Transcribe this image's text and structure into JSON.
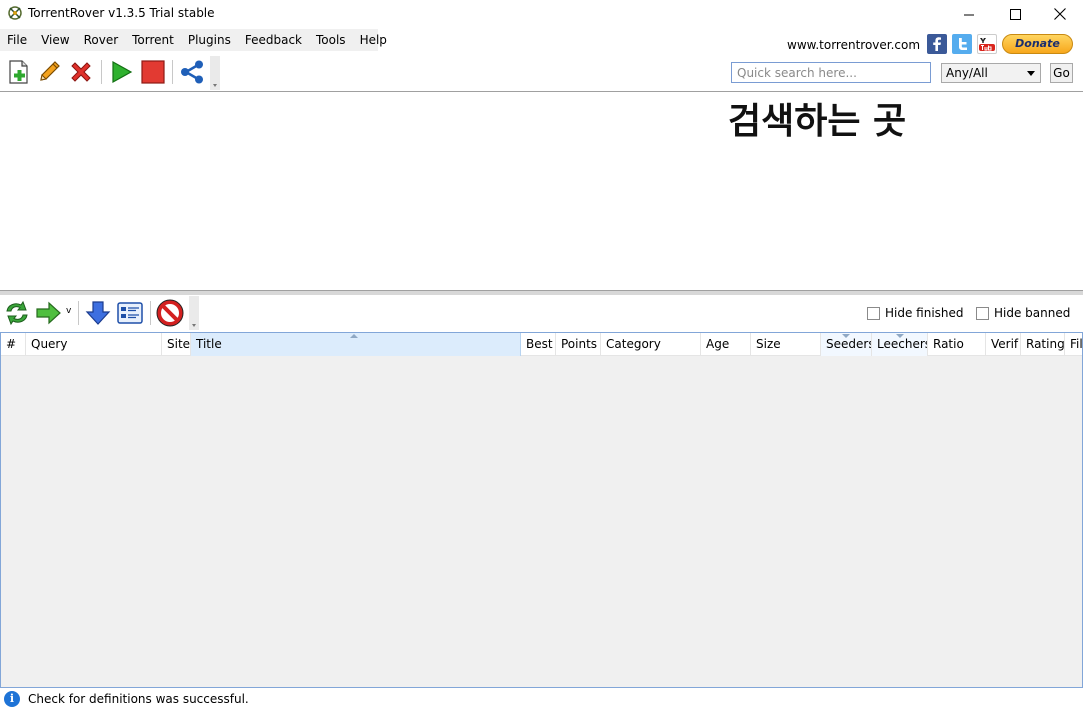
{
  "window": {
    "title": "TorrentRover v1.3.5 Trial stable"
  },
  "menu": [
    "File",
    "View",
    "Rover",
    "Torrent",
    "Plugins",
    "Feedback",
    "Tools",
    "Help"
  ],
  "header": {
    "site_link": "www.torrentrover.com",
    "donate_label": "Donate",
    "social_icons": [
      "facebook-icon",
      "twitter-icon",
      "youtube-icon"
    ]
  },
  "search": {
    "placeholder": "Quick search here...",
    "value": "",
    "scope": "Any/All",
    "go_label": "Go"
  },
  "annotation_text": "검색하는 곳",
  "filters": {
    "hide_finished": "Hide finished",
    "hide_banned": "Hide banned"
  },
  "grid": {
    "columns": [
      "#",
      "Query",
      "Site",
      "Title",
      "Best",
      "Points",
      "Category",
      "Age",
      "Size",
      "Seeders",
      "Leechers",
      "Ratio",
      "Verif",
      "Rating",
      "Fil"
    ],
    "sorted_column": "Title",
    "rows": []
  },
  "status": {
    "text": "Check for definitions was successful."
  },
  "colors": {
    "accent": "#1e73d6",
    "grid_border": "#82a6d8",
    "sorted_header": "#dcecfc"
  }
}
